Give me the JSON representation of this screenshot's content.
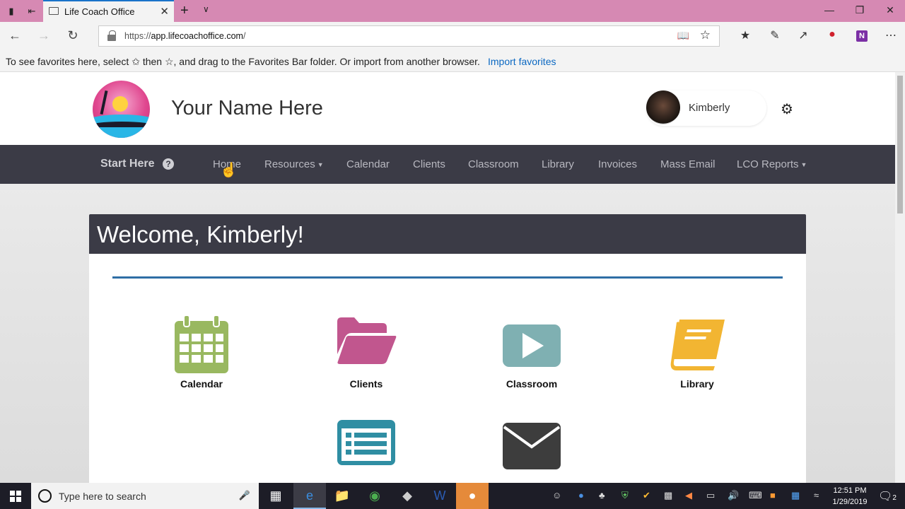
{
  "browser": {
    "tab_title": "Life Coach Office",
    "url_scheme": "https://",
    "url_host": "app.lifecoachoffice.com",
    "url_path": "/",
    "favorites_message": "To see favorites here, select  ✩  then ☆, and drag to the Favorites Bar folder. Or import from another browser.",
    "favorites_link": "Import favorites"
  },
  "site": {
    "name": "Your Name Here",
    "user_name": "Kimberly"
  },
  "nav": {
    "start_here": "Start Here",
    "help": "?",
    "items": [
      {
        "label": "Home"
      },
      {
        "label": "Resources",
        "dropdown": true
      },
      {
        "label": "Calendar"
      },
      {
        "label": "Clients"
      },
      {
        "label": "Classroom"
      },
      {
        "label": "Library"
      },
      {
        "label": "Invoices"
      },
      {
        "label": "Mass Email"
      },
      {
        "label": "LCO Reports",
        "dropdown": true
      }
    ]
  },
  "welcome": "Welcome, Kimberly!",
  "tiles": [
    {
      "label": "Calendar",
      "icon": "calendar-icon",
      "color": "#99b860"
    },
    {
      "label": "Clients",
      "icon": "folder-open-icon",
      "color": "#c1568e"
    },
    {
      "label": "Classroom",
      "icon": "play-icon",
      "color": "#7fb0b2"
    },
    {
      "label": "Library",
      "icon": "book-icon",
      "color": "#f2b532"
    },
    {
      "label": "",
      "icon": "list-icon",
      "color": "#2f8ea3"
    },
    {
      "label": "",
      "icon": "envelope-icon",
      "color": "#3d3d3d"
    }
  ],
  "taskbar": {
    "search_placeholder": "Type here to search",
    "time": "12:51 PM",
    "date": "1/29/2019",
    "notifications": "2"
  }
}
